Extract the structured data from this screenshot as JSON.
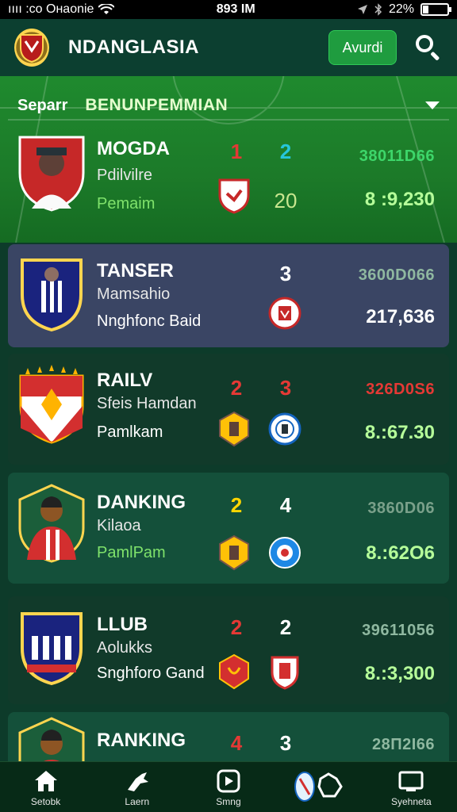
{
  "status": {
    "carrier": "ıııı :co Oнаonie",
    "time": "893 IM",
    "battery": "22%",
    "battery_level": 0.22
  },
  "header": {
    "title": "NDANGLASIA",
    "action_label": "Avurdi",
    "logo_icon": "club-crest-icon",
    "search_icon": "search-icon"
  },
  "section": {
    "prefix": "Separr",
    "title": "BENUNPEMMIAN"
  },
  "cards": [
    {
      "name": "MOGDA",
      "sub": "Pdilvilre",
      "league": "Pemaim",
      "score1": "1",
      "score2": "2",
      "score3": "20",
      "code": "38011D66",
      "value": "8 :9,230",
      "score1_color": "#e53935",
      "score2_color": "#26c6da",
      "code_color": "#3dd66a",
      "value_color": "#b6ff9a",
      "league_color": "#7fe26b"
    },
    {
      "name": "TANSER",
      "sub": "Mamsahio",
      "league": "Nnghfonc Baid",
      "score1": "",
      "score2": "3",
      "score3": "",
      "code": "3600D066",
      "value": "217,636",
      "score1_color": "#ffffff",
      "score2_color": "#ffffff",
      "code_color": "#8fb8a0",
      "value_color": "#ffffff",
      "league_color": "#ffffff"
    },
    {
      "name": "RAILV",
      "sub": "Sfeis Hamdan",
      "league": "Pamlkam",
      "score1": "2",
      "score2": "3",
      "score3": "",
      "code": "326D0S6",
      "value": "8.:67.30",
      "score1_color": "#e53935",
      "score2_color": "#e53935",
      "code_color": "#e53935",
      "value_color": "#b6ff9a",
      "league_color": "#ffffff"
    },
    {
      "name": "DANKING",
      "sub": "Kilaoa",
      "league": "PamlPam",
      "score1": "2",
      "score2": "4",
      "score3": "",
      "code": "3860D06",
      "value": "8.:62O6",
      "score1_color": "#ffd600",
      "score2_color": "#ffffff",
      "code_color": "#7aa08a",
      "value_color": "#b6ff9a",
      "league_color": "#7fe26b"
    },
    {
      "name": "LLUB",
      "sub": "Aolukks",
      "league": "Snghforo Gand",
      "score1": "2",
      "score2": "2",
      "score3": "",
      "code": "39611056",
      "value": "8.:3,300",
      "score1_color": "#e53935",
      "score2_color": "#ffffff",
      "code_color": "#8fb8a0",
      "value_color": "#b6ff9a",
      "league_color": "#ffffff"
    },
    {
      "name": "RANKING",
      "sub": "",
      "league": "",
      "score1": "4",
      "score2": "3",
      "score3": "",
      "code": "28П2I66",
      "value": "",
      "score1_color": "#e53935",
      "score2_color": "#ffffff",
      "code_color": "#8fb8a0",
      "value_color": "#ffffff",
      "league_color": "#ffffff"
    }
  ],
  "nav": [
    {
      "label": "Setobk",
      "icon": "home-icon"
    },
    {
      "label": "Laern",
      "icon": "kick-icon"
    },
    {
      "label": "Smng",
      "icon": "play-icon"
    },
    {
      "label": "",
      "icon": "team-crest-icon"
    },
    {
      "label": "Syehneta",
      "icon": "screen-icon"
    }
  ],
  "colors": {
    "accent": "#1f9c3f",
    "header_bg": "#0c3f30",
    "card_highlight": "#3a4564",
    "card_dark": "#113a2a",
    "nav_bg": "#072a17"
  }
}
